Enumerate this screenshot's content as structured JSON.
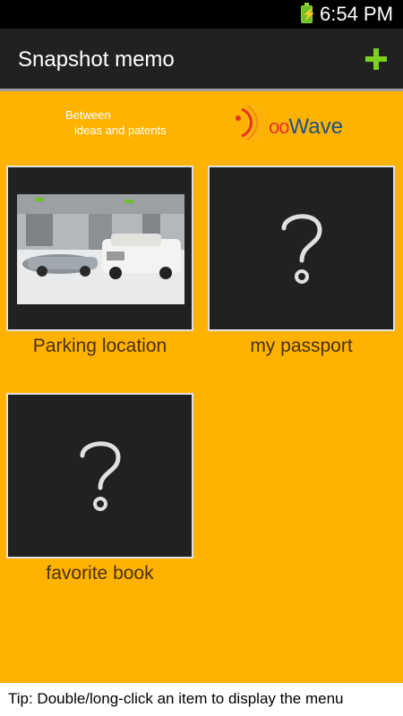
{
  "status_bar": {
    "time": "6:54 PM",
    "battery_icon": "battery-charging-icon"
  },
  "action_bar": {
    "title": "Snapshot memo",
    "add_icon": "plus-icon",
    "accent": "#7cd11e"
  },
  "banner": {
    "tagline_line1": "Between",
    "tagline_line2": "ideas and patents",
    "logo_prefix": "D",
    "logo_oo": "oo",
    "logo_suffix": "Wave"
  },
  "memos": [
    {
      "label": "Parking location",
      "thumbnail": "parking-garage-photo"
    },
    {
      "label": "my passport",
      "thumbnail": "question-mark-icon"
    },
    {
      "label": "favorite book",
      "thumbnail": "question-mark-icon"
    }
  ],
  "tip": "Tip: Double/long-click an item to display the menu",
  "colors": {
    "background": "#ffb300",
    "action_bar": "#212121",
    "card": "#212121"
  }
}
